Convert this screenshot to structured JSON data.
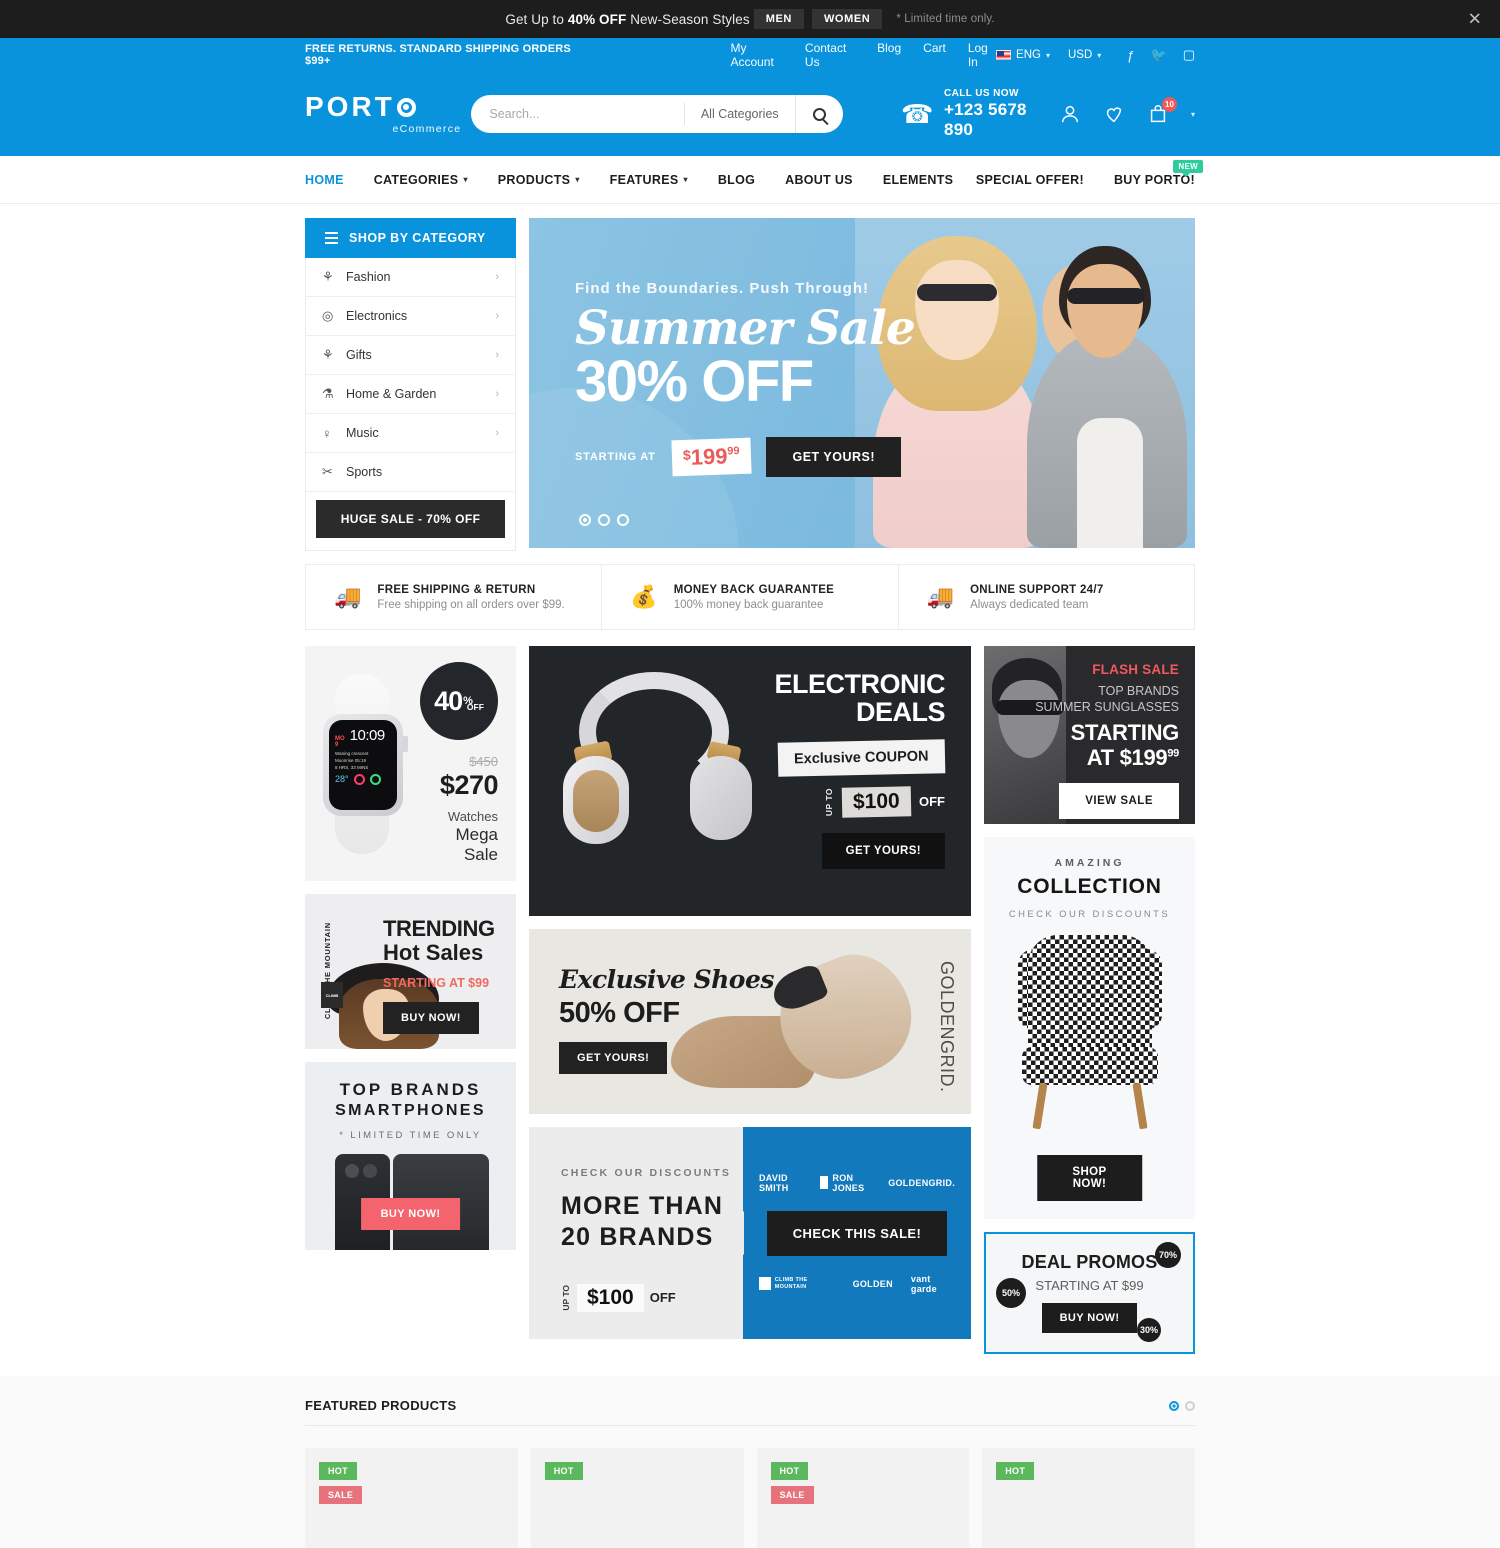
{
  "promo": {
    "text_before": "Get Up to ",
    "text_bold": "40% OFF",
    "text_after": " New-Season Styles",
    "btn_men": "MEN",
    "btn_women": "WOMEN",
    "note": "* Limited time only.",
    "close_icon": "close-icon"
  },
  "header": {
    "shipping_note": "FREE RETURNS. STANDARD SHIPPING ORDERS $99+",
    "links": [
      "My Account",
      "Contact Us",
      "Blog",
      "Cart",
      "Log In"
    ],
    "language": "ENG",
    "currency": "USD",
    "socials": [
      "facebook-icon",
      "twitter-icon",
      "instagram-icon"
    ],
    "logo_word": "PORT",
    "logo_sub": "eCommerce",
    "search_placeholder": "Search...",
    "search_value": "",
    "categories_label": "All Categories",
    "call_label": "CALL US NOW",
    "call_number": "+123 5678 890",
    "cart_count": "10"
  },
  "nav": {
    "items": [
      {
        "label": "HOME",
        "caret": ""
      },
      {
        "label": "CATEGORIES",
        "caret": "⌄"
      },
      {
        "label": "PRODUCTS",
        "caret": "⌄"
      },
      {
        "label": "FEATURES",
        "caret": "⌄"
      },
      {
        "label": "BLOG",
        "caret": ""
      },
      {
        "label": "ABOUT US",
        "caret": ""
      },
      {
        "label": "ELEMENTS",
        "caret": ""
      }
    ],
    "special_offer": "SPECIAL OFFER!",
    "buy_porto": "BUY PORTO!",
    "new_tag": "NEW"
  },
  "sidebar": {
    "title": "SHOP BY CATEGORY",
    "items": [
      {
        "label": "Fashion",
        "icon": "⚘",
        "arrow": "›"
      },
      {
        "label": "Electronics",
        "icon": "◎",
        "arrow": "›"
      },
      {
        "label": "Gifts",
        "icon": "⚘",
        "arrow": "›"
      },
      {
        "label": "Home & Garden",
        "icon": "⚗",
        "arrow": "›"
      },
      {
        "label": "Music",
        "icon": "♀",
        "arrow": "›"
      },
      {
        "label": "Sports",
        "icon": "✂",
        "arrow": ""
      }
    ],
    "sale_button": "HUGE SALE - 70% OFF"
  },
  "hero": {
    "kicker": "Find the Boundaries. Push Through!",
    "script": "Summer Sale",
    "big": "30% OFF",
    "starting_at": "STARTING AT",
    "currency": "$",
    "price": "199",
    "cents": "99",
    "cta": "GET YOURS!",
    "slide_count": 3,
    "active_slide": 1
  },
  "services": [
    {
      "icon": "truck-icon",
      "title": "FREE SHIPPING & RETURN",
      "sub": "Free shipping on all orders over $99."
    },
    {
      "icon": "dollar-icon",
      "title": "MONEY BACK GUARANTEE",
      "sub": "100% money back guarantee"
    },
    {
      "icon": "truck-icon",
      "title": "ONLINE SUPPORT 24/7",
      "sub": "Always dedicated team"
    }
  ],
  "banners": {
    "watch": {
      "discount_num": "40",
      "discount_pct": "%",
      "discount_off": "OFF",
      "old_price": "$450",
      "new_price": "$270",
      "line1": "Watches",
      "line2": "Mega Sale",
      "watch_day": "MO",
      "watch_date": "9",
      "watch_time": "10:09",
      "watch_label1": "Waning crescent",
      "watch_label2": "Moonrise 05:19",
      "watch_label3": "8 HRS, 33 MINS",
      "watch_temp": "28°"
    },
    "trending": {
      "side_text": "CLIMB THE MOUNTAIN",
      "chip": "CLIMB",
      "title1": "TRENDING",
      "title2": "Hot Sales",
      "price_line": "STARTING AT $99",
      "cta": "BUY NOW!"
    },
    "smartphones": {
      "title1": "TOP BRANDS",
      "title2": "SMARTPHONES",
      "note": "* LIMITED TIME ONLY",
      "cta": "BUY NOW!"
    },
    "electronic": {
      "title1": "ELECTRONIC",
      "title2": "DEALS",
      "coupon": "Exclusive COUPON",
      "upto": "UP TO",
      "amount": "$100",
      "off": "OFF",
      "cta": "GET YOURS!"
    },
    "shoes": {
      "script": "Exclusive Shoes",
      "big": "50% OFF",
      "cta": "GET YOURS!",
      "brand_bold": "GOLDEN",
      "brand_thin": "GRID."
    },
    "more_brands": {
      "kicker": "CHECK OUR DISCOUNTS",
      "title1": "MORE THAN",
      "title2": "20 BRANDS",
      "upto": "UP TO",
      "amount": "$100",
      "off": "OFF",
      "cta": "CHECK THIS SALE!",
      "logos_top": [
        "DAVID SMITH",
        "RON JONES",
        "GOLDENGRID."
      ],
      "logos_bottom": [
        "CLIMB THE MOUNTAIN",
        "GOLDEN",
        "vant garde"
      ]
    },
    "flash": {
      "tag": "FLASH SALE",
      "line1": "TOP BRANDS",
      "line2": "SUMMER SUNGLASSES",
      "line3": "STARTING",
      "line4": "AT $199",
      "cents": "99",
      "cta": "VIEW SALE"
    },
    "collection": {
      "kicker": "AMAZING",
      "title": "COLLECTION",
      "sub": "CHECK OUR DISCOUNTS",
      "cta": "SHOP NOW!"
    },
    "deal_promos": {
      "title": "DEAL PROMOS",
      "sub": "STARTING AT $99",
      "cta": "BUY NOW!",
      "badge_70": "70%",
      "badge_50": "50%",
      "badge_30": "30%"
    }
  },
  "featured": {
    "title": "FEATURED PRODUCTS",
    "cards": [
      {
        "hot": "HOT",
        "sale": "SALE"
      },
      {
        "hot": "HOT",
        "sale": ""
      },
      {
        "hot": "HOT",
        "sale": "SALE"
      },
      {
        "hot": "HOT",
        "sale": ""
      }
    ]
  },
  "colors": {
    "brand_blue": "#0a93dd",
    "dark": "#1d1d1d",
    "accent_red": "#ee5a5a",
    "green": "#5cb85c"
  }
}
